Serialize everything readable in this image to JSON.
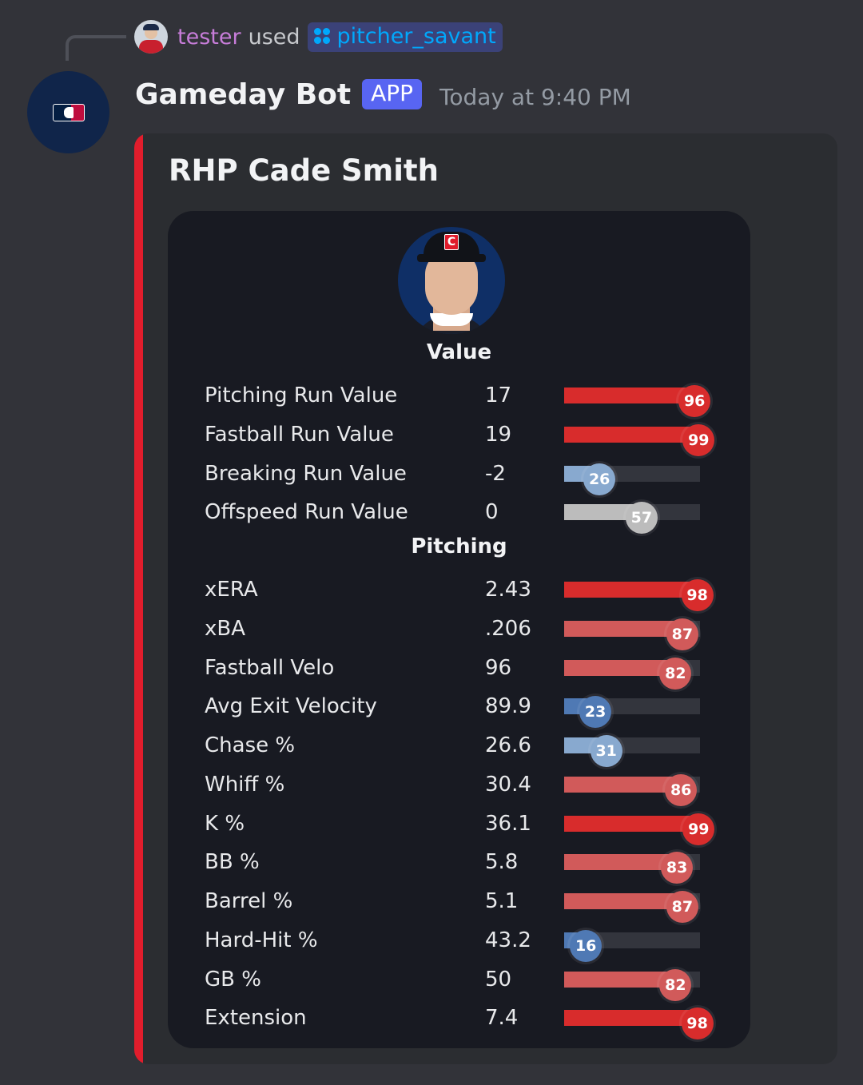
{
  "reply": {
    "username": "tester",
    "action": "used",
    "command": "pitcher_savant"
  },
  "message": {
    "bot_name": "Gameday Bot",
    "badge": "APP",
    "timestamp": "Today at 9:40 PM"
  },
  "embed": {
    "title": "RHP Cade Smith",
    "accent_color": "#e11d2c",
    "sections": [
      {
        "title": "Value",
        "stats": [
          {
            "label": "Pitching Run Value",
            "value": "17",
            "percentile": 96
          },
          {
            "label": "Fastball Run Value",
            "value": "19",
            "percentile": 99
          },
          {
            "label": "Breaking Run Value",
            "value": "-2",
            "percentile": 26
          },
          {
            "label": "Offspeed Run Value",
            "value": "0",
            "percentile": 57
          }
        ]
      },
      {
        "title": "Pitching",
        "stats": [
          {
            "label": "xERA",
            "value": "2.43",
            "percentile": 98
          },
          {
            "label": "xBA",
            "value": ".206",
            "percentile": 87
          },
          {
            "label": "Fastball Velo",
            "value": "96",
            "percentile": 82
          },
          {
            "label": "Avg Exit Velocity",
            "value": "89.9",
            "percentile": 23
          },
          {
            "label": "Chase %",
            "value": "26.6",
            "percentile": 31
          },
          {
            "label": "Whiff %",
            "value": "30.4",
            "percentile": 86
          },
          {
            "label": "K %",
            "value": "36.1",
            "percentile": 99
          },
          {
            "label": "BB %",
            "value": "5.8",
            "percentile": 83
          },
          {
            "label": "Barrel %",
            "value": "5.1",
            "percentile": 87
          },
          {
            "label": "Hard-Hit %",
            "value": "43.2",
            "percentile": 16
          },
          {
            "label": "GB %",
            "value": "50",
            "percentile": 82
          },
          {
            "label": "Extension",
            "value": "7.4",
            "percentile": 98
          }
        ]
      }
    ]
  }
}
